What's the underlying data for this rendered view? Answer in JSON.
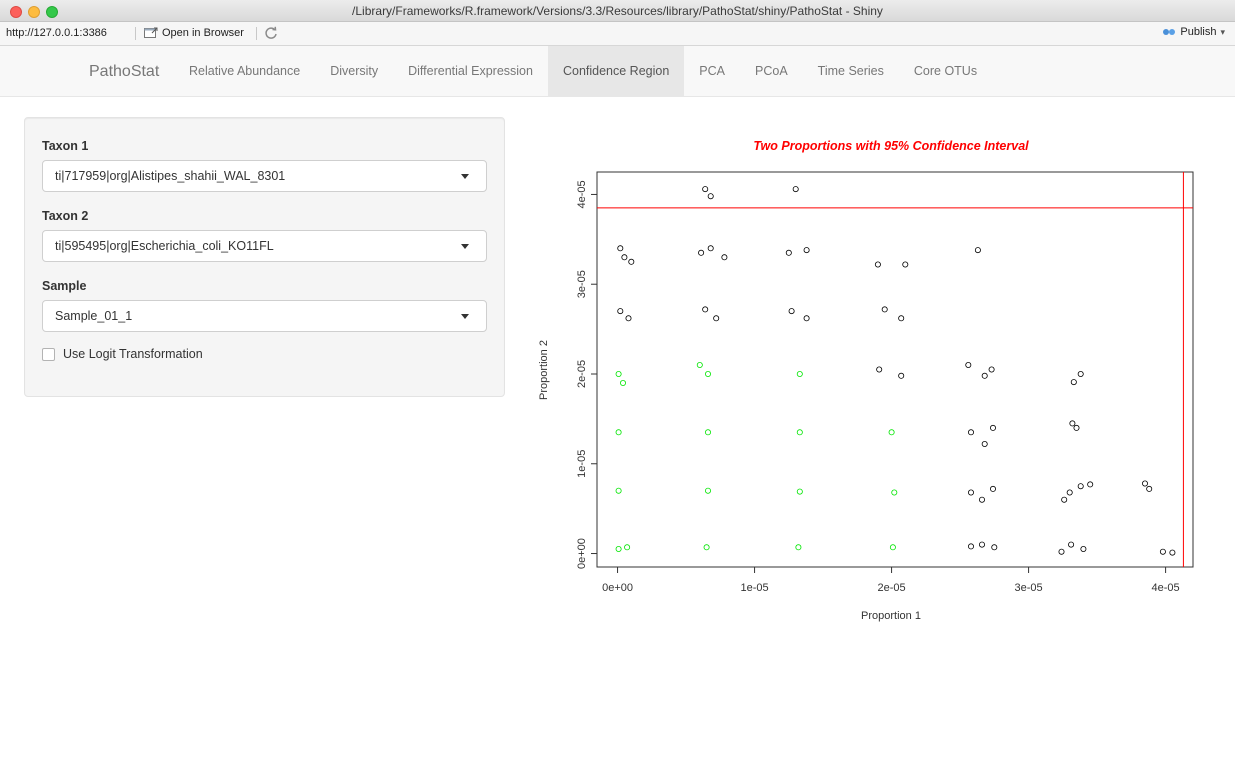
{
  "window": {
    "title": "/Library/Frameworks/R.framework/Versions/3.3/Resources/library/PathoStat/shiny/PathoStat - Shiny"
  },
  "toolbar": {
    "url": "http://127.0.0.1:3386",
    "open_in_browser": "Open in Browser",
    "publish": "Publish"
  },
  "navbar": {
    "brand": "PathoStat",
    "tabs": [
      {
        "label": "Relative Abundance"
      },
      {
        "label": "Diversity"
      },
      {
        "label": "Differential Expression"
      },
      {
        "label": "Confidence Region"
      },
      {
        "label": "PCA"
      },
      {
        "label": "PCoA"
      },
      {
        "label": "Time Series"
      },
      {
        "label": "Core OTUs"
      }
    ],
    "active_tab": "Confidence Region"
  },
  "sidebar": {
    "taxon1": {
      "label": "Taxon 1",
      "value": "ti|717959|org|Alistipes_shahii_WAL_8301"
    },
    "taxon2": {
      "label": "Taxon 2",
      "value": "ti|595495|org|Escherichia_coli_KO11FL"
    },
    "sample": {
      "label": "Sample",
      "value": "Sample_01_1"
    },
    "logit": {
      "label": "Use Logit Transformation",
      "checked": false
    }
  },
  "colors": {
    "inside": "#00e600",
    "outside": "#000000",
    "limit_line": "#ff0000",
    "title": "#ff0000"
  },
  "chart_data": {
    "type": "scatter",
    "title": "Two Proportions with 95% Confidence Interval",
    "xlabel": "Proportion 1",
    "ylabel": "Proportion 2",
    "xlim": [
      -1.5e-06,
      4.2e-05
    ],
    "ylim": [
      -1.5e-06,
      4.25e-05
    ],
    "xticks": [
      0,
      1e-05,
      2e-05,
      3e-05,
      4e-05
    ],
    "xtick_labels": [
      "0e+00",
      "1e-05",
      "2e-05",
      "3e-05",
      "4e-05"
    ],
    "yticks": [
      0,
      1e-05,
      2e-05,
      3e-05,
      4e-05
    ],
    "ytick_labels": [
      "0e+00",
      "1e-05",
      "2e-05",
      "3e-05",
      "4e-05"
    ],
    "limit_lines": {
      "x": 4.13e-05,
      "y": 3.85e-05
    },
    "series": [
      {
        "name": "",
        "color": "#00e600",
        "points": [
          [
            8e-08,
            5e-07
          ],
          [
            7e-07,
            7e-07
          ],
          [
            6.5e-06,
            7e-07
          ],
          [
            1.32e-05,
            7e-07
          ],
          [
            2.01e-05,
            7e-07
          ],
          [
            8e-08,
            7e-06
          ],
          [
            6.6e-06,
            7e-06
          ],
          [
            1.33e-05,
            6.9e-06
          ],
          [
            2.02e-05,
            6.8e-06
          ],
          [
            8e-08,
            1.35e-05
          ],
          [
            6.6e-06,
            1.35e-05
          ],
          [
            1.33e-05,
            1.35e-05
          ],
          [
            2e-05,
            1.35e-05
          ],
          [
            8e-08,
            2e-05
          ],
          [
            6.6e-06,
            2e-05
          ],
          [
            1.33e-05,
            2e-05
          ],
          [
            4e-07,
            1.9e-05
          ],
          [
            6e-06,
            2.1e-05
          ]
        ]
      },
      {
        "name": "",
        "color": "#000000",
        "points": [
          [
            2e-07,
            3.4e-05
          ],
          [
            5e-07,
            3.3e-05
          ],
          [
            1e-06,
            3.25e-05
          ],
          [
            6.1e-06,
            3.35e-05
          ],
          [
            6.8e-06,
            3.4e-05
          ],
          [
            7.8e-06,
            3.3e-05
          ],
          [
            1.25e-05,
            3.35e-05
          ],
          [
            1.38e-05,
            3.38e-05
          ],
          [
            1.9e-05,
            3.22e-05
          ],
          [
            2.1e-05,
            3.22e-05
          ],
          [
            2.63e-05,
            3.38e-05
          ],
          [
            6.4e-06,
            4.06e-05
          ],
          [
            6.8e-06,
            3.98e-05
          ],
          [
            1.3e-05,
            4.06e-05
          ],
          [
            2e-07,
            2.7e-05
          ],
          [
            8e-07,
            2.62e-05
          ],
          [
            6.4e-06,
            2.72e-05
          ],
          [
            7.2e-06,
            2.62e-05
          ],
          [
            1.27e-05,
            2.7e-05
          ],
          [
            1.38e-05,
            2.62e-05
          ],
          [
            1.95e-05,
            2.72e-05
          ],
          [
            2.07e-05,
            2.62e-05
          ],
          [
            1.91e-05,
            2.05e-05
          ],
          [
            2.07e-05,
            1.98e-05
          ],
          [
            2.56e-05,
            2.1e-05
          ],
          [
            2.68e-05,
            1.98e-05
          ],
          [
            2.73e-05,
            2.05e-05
          ],
          [
            3.33e-05,
            1.91e-05
          ],
          [
            3.38e-05,
            2e-05
          ],
          [
            2.58e-05,
            1.35e-05
          ],
          [
            2.68e-05,
            1.22e-05
          ],
          [
            2.74e-05,
            1.4e-05
          ],
          [
            3.32e-05,
            1.45e-05
          ],
          [
            3.35e-05,
            1.4e-05
          ],
          [
            2.58e-05,
            6.8e-06
          ],
          [
            2.66e-05,
            6e-06
          ],
          [
            2.74e-05,
            7.2e-06
          ],
          [
            3.26e-05,
            6e-06
          ],
          [
            3.3e-05,
            6.8e-06
          ],
          [
            3.38e-05,
            7.5e-06
          ],
          [
            3.45e-05,
            7.7e-06
          ],
          [
            3.85e-05,
            7.8e-06
          ],
          [
            3.88e-05,
            7.2e-06
          ],
          [
            2.58e-05,
            8e-07
          ],
          [
            2.66e-05,
            1e-06
          ],
          [
            2.75e-05,
            7e-07
          ],
          [
            3.24e-05,
            2e-07
          ],
          [
            3.31e-05,
            1e-06
          ],
          [
            3.4e-05,
            5e-07
          ],
          [
            3.98e-05,
            2e-07
          ],
          [
            4.05e-05,
            1e-07
          ]
        ]
      }
    ],
    "legend": "none",
    "grid": false
  }
}
